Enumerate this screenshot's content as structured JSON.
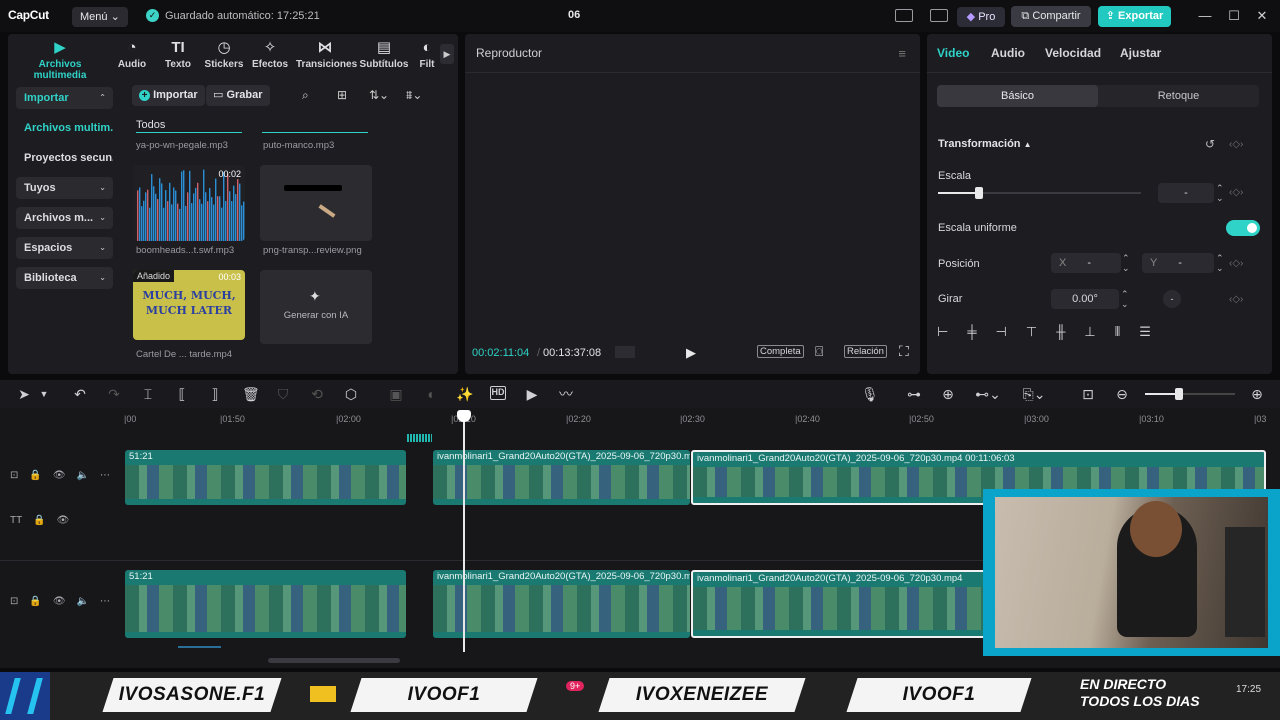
{
  "titlebar": {
    "logo": "CapCut",
    "menu_label": "Menú ⌄",
    "autosave": "Guardado automático: 17:25:21",
    "project_title": "06",
    "pro_label": "Pro",
    "share_label": "Compartir",
    "export_label": "Exportar"
  },
  "media_tabs": [
    {
      "label": "Archivos multimedia",
      "icon": "▶"
    },
    {
      "label": "Audio",
      "icon": "◔"
    },
    {
      "label": "Texto",
      "icon": "TI"
    },
    {
      "label": "Stickers",
      "icon": "◷"
    },
    {
      "label": "Efectos",
      "icon": "✧"
    },
    {
      "label": "Transiciones",
      "icon": "⋈"
    },
    {
      "label": "Subtítulos",
      "icon": "▤"
    },
    {
      "label": "Filt",
      "icon": "◐"
    }
  ],
  "sidebar": [
    {
      "label": "Importar",
      "chev": "⌃"
    },
    {
      "label": "Archivos multim...",
      "chev": ""
    },
    {
      "label": "Proyectos secun...",
      "chev": ""
    },
    {
      "label": "Tuyos",
      "chev": "⌄"
    },
    {
      "label": "Archivos m...",
      "chev": "⌄"
    },
    {
      "label": "Espacios",
      "chev": "⌄"
    },
    {
      "label": "Biblioteca",
      "chev": "⌄"
    }
  ],
  "media_toolbar": {
    "import_label": "Importar",
    "record_label": "Grabar"
  },
  "media": {
    "section_label": "Todos",
    "prev_captions": [
      "ya-po-wn-pegale.mp3",
      "puto-manco.mp3"
    ],
    "items": [
      {
        "caption": "boomheads...t.swf.mp3",
        "duration": "00:02"
      },
      {
        "caption": "png-transp...review.png",
        "duration": ""
      },
      {
        "caption": "Cartel De ... tarde.mp4",
        "duration": "00:03",
        "badge": "Añadido",
        "thumb_text": "MUCH, MUCH, MUCH LATER"
      },
      {
        "caption": "Generar con IA",
        "duration": ""
      }
    ]
  },
  "player": {
    "title": "Reproductor",
    "current_time": "00:02:11:04",
    "total_time": "00:13:37:08",
    "full_label": "Completa",
    "ratio_label": "Relación"
  },
  "props": {
    "tabs": [
      "Video",
      "Audio",
      "Velocidad",
      "Ajustar"
    ],
    "segments": [
      "Básico",
      "Retoque"
    ],
    "section_title": "Transformación",
    "scale_label": "Escala",
    "scale_value": "-",
    "scale_level": 0.2,
    "uniform_label": "Escala uniforme",
    "position_label": "Posición",
    "pos_x_label": "X",
    "pos_x_value": "-",
    "pos_y_label": "Y",
    "pos_y_value": "-",
    "rotate_label": "Girar",
    "rotate_value": "0.00°"
  },
  "timeline": {
    "ruler": [
      "|00",
      "|01:50",
      "|02:00",
      "|02:10",
      "|02:20",
      "|02:30",
      "|02:40",
      "|02:50",
      "|03:00",
      "|03:10",
      "|03"
    ],
    "clip_labels": {
      "a1": "51:21",
      "a2": "ivanmolinari1_Grand20Auto20(GTA)_2025-09-06_720p30.m",
      "a3": "ivanmolinari1_Grand20Auto20(GTA)_2025-09-06_720p30.mp4   00:11:06:03",
      "b1": "51:21",
      "b2": "ivanmolinari1_Grand20Auto20(GTA)_2025-09-06_720p30.m",
      "b3": "ivanmolinari1_Grand20Auto20(GTA)_2025-09-06_720p30.mp4"
    }
  },
  "banner": {
    "plates": [
      "IVOSASONE.F1",
      "IVOOF1",
      "IVOXENEIZEE",
      "IVOOF1"
    ],
    "live_text": "EN DIRECTO TODOS LOS DIAS",
    "notification": "9+",
    "clock": "17:25"
  },
  "colors": {
    "accent": "#2fd3c8",
    "export": "#21c9c0",
    "clip": "#1a7a72",
    "cam_frame": "#0aa3c9"
  }
}
